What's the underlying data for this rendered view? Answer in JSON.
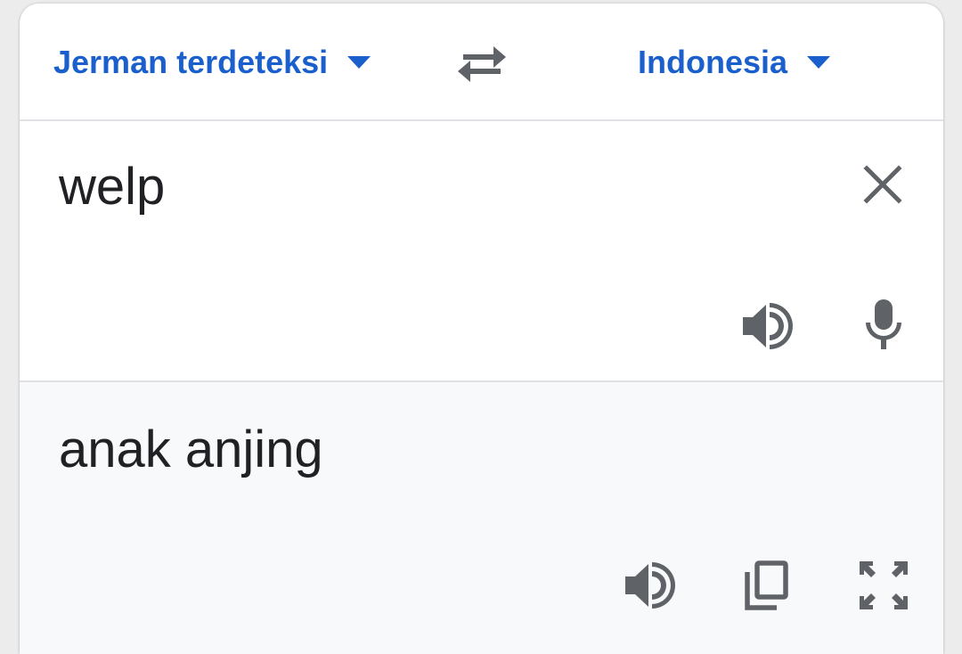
{
  "languages": {
    "source_label": "Jerman terdeteksi",
    "target_label": "Indonesia"
  },
  "input": {
    "text": "welp"
  },
  "output": {
    "text": "anak anjing"
  },
  "icons": {
    "dropdown": "caret-down-icon",
    "swap": "swap-arrows-icon",
    "clear": "close-icon",
    "speaker": "volume-icon",
    "mic": "microphone-icon",
    "copy": "copy-icon",
    "fullscreen": "fullscreen-icon"
  },
  "colors": {
    "accent": "#1a5fcc",
    "icon": "#5f6368",
    "text": "#202124",
    "output_bg": "#f8f9fa"
  }
}
